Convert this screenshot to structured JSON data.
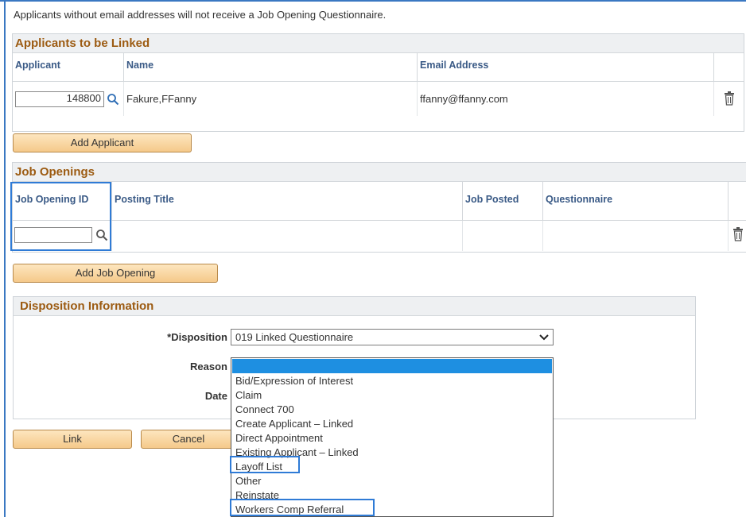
{
  "notice": "Applicants without email addresses will not receive a Job Opening Questionnaire.",
  "applicants": {
    "title": "Applicants to be Linked",
    "columns": [
      "Applicant",
      "Name",
      "Email Address"
    ],
    "rows": [
      {
        "applicant": "148800",
        "name": "Fakure,FFanny",
        "email": "ffanny@ffanny.com"
      }
    ],
    "add_button": "Add Applicant"
  },
  "job_openings": {
    "title": "Job Openings",
    "columns": [
      "Job Opening ID",
      "Posting Title",
      "Job Posted",
      "Questionnaire"
    ],
    "rows": [
      {
        "job_opening_id": "",
        "posting_title": "",
        "job_posted": "",
        "questionnaire": ""
      }
    ],
    "add_button": "Add Job Opening"
  },
  "disposition": {
    "title": "Disposition Information",
    "disposition_label": "*Disposition",
    "disposition_value": "019 Linked Questionnaire",
    "reason_label": "Reason",
    "date_label": "Date",
    "reason_options": [
      "",
      "Bid/Expression of Interest",
      "Claim",
      "Connect 700",
      "Create Applicant – Linked",
      "Direct Appointment",
      "Existing Applicant – Linked",
      "Layoff List",
      "Other",
      "Reinstate",
      "Workers Comp Referral"
    ]
  },
  "actions": {
    "link": "Link",
    "cancel": "Cancel"
  },
  "colors": {
    "accent": "#2f7bd6",
    "section_title": "#9c5b12",
    "header_text": "#3a5a86",
    "button_bg": "#f5c98a"
  },
  "icons": {
    "lookup": "magnifier-icon",
    "delete": "trash-icon",
    "dropdown": "chevron-down-icon"
  }
}
